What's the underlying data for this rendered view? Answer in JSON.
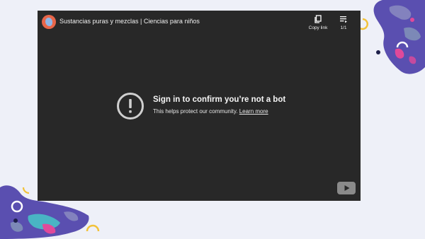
{
  "video": {
    "title": "Sustancias puras y mezclas | Ciencias para niños"
  },
  "actions": {
    "copy_link_label": "Copy link",
    "playlist_count": "1/1"
  },
  "notice": {
    "title": "Sign in to confirm you’re not a bot",
    "body": "This helps protect our community.",
    "link": "Learn more"
  },
  "colors": {
    "page_background": "#eef0f8",
    "player_background": "#282828",
    "decor_purple": "#5a4fb0",
    "decor_yellow": "#f2c23a",
    "decor_pink": "#e0499a",
    "decor_teal": "#47c5c8"
  },
  "icons": {
    "copy": "copy-icon",
    "playlist": "playlist-icon",
    "alert": "alert-circle-icon",
    "logo": "youtube-logo-icon"
  }
}
